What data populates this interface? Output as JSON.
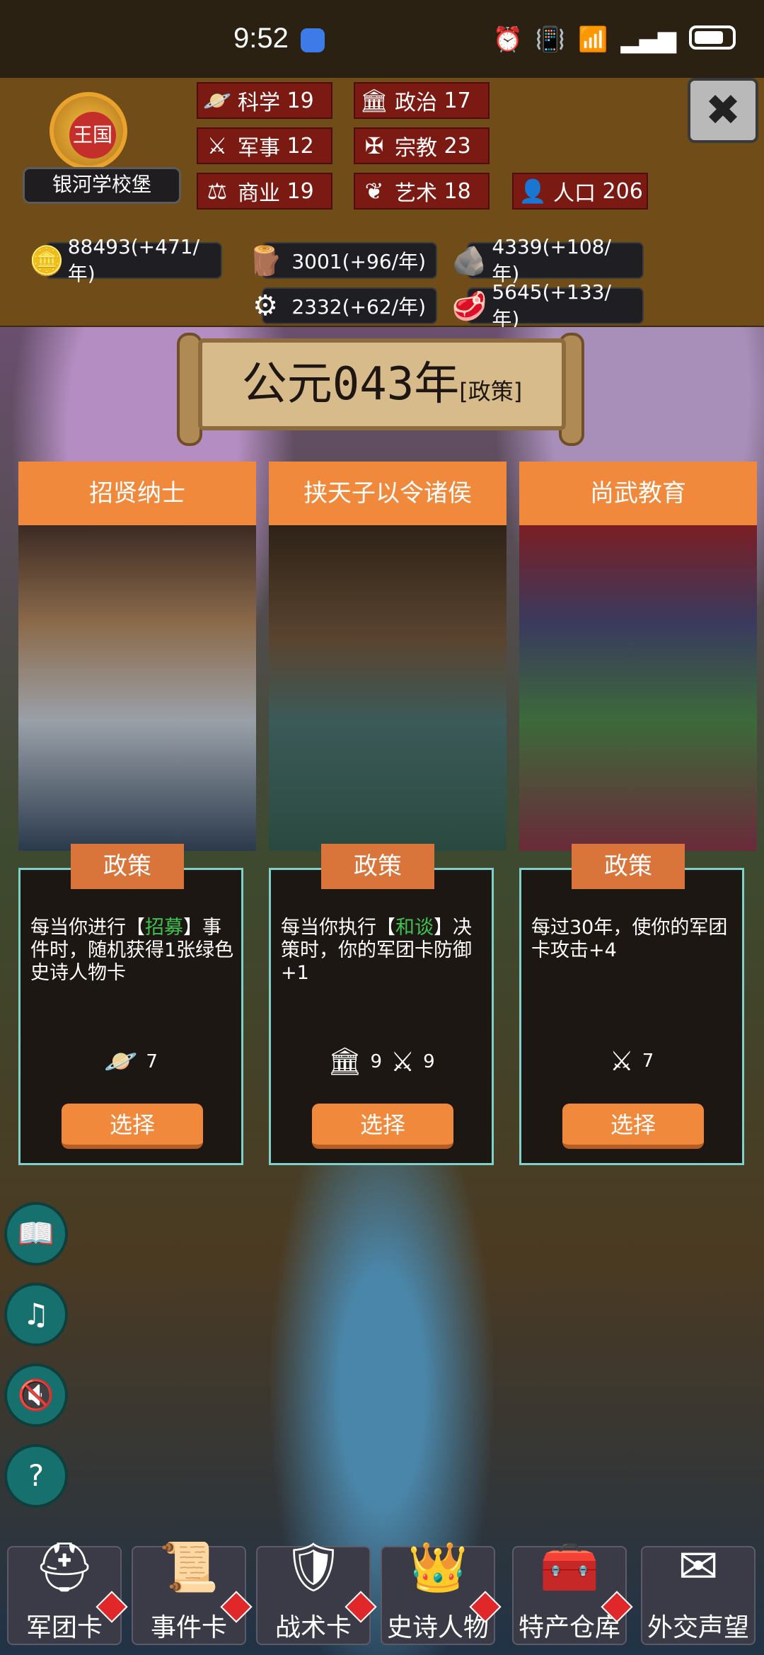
{
  "status_bar": {
    "time": "9:52"
  },
  "header": {
    "emblem_label": "王国",
    "kingdom_name": "银河学校堡",
    "close_symbol": "✖",
    "stats": [
      {
        "icon": "planet-icon",
        "glyph": "🪐",
        "label": "科学",
        "value": "19"
      },
      {
        "icon": "government-icon",
        "glyph": "🏛",
        "label": "政治",
        "value": "17"
      },
      {
        "icon": "crossed-swords-icon",
        "glyph": "⚔",
        "label": "军事",
        "value": "12"
      },
      {
        "icon": "religion-icon",
        "glyph": "✠",
        "label": "宗教",
        "value": "23"
      },
      {
        "icon": "scales-icon",
        "glyph": "⚖",
        "label": "商业",
        "value": "19"
      },
      {
        "icon": "art-icon",
        "glyph": "❦",
        "label": "艺术",
        "value": "18"
      },
      {
        "icon": "person-icon",
        "glyph": "👤",
        "label": "人口",
        "value": "206"
      }
    ],
    "resources": [
      {
        "icon": "coins-icon",
        "glyph": "🪙",
        "text": "88493(+471/年)"
      },
      {
        "icon": "wood-icon",
        "glyph": "🪵",
        "text": "3001(+96/年)"
      },
      {
        "icon": "stone-icon",
        "glyph": "🪨",
        "text": "4339(+108/年)"
      },
      {
        "icon": "tech-icon",
        "glyph": "⚙",
        "text": "2332(+62/年)"
      },
      {
        "icon": "meat-icon",
        "glyph": "🥩",
        "text": "5645(+133/年)"
      }
    ]
  },
  "banner": {
    "year": "公元043年",
    "phase": "[政策]"
  },
  "cards": [
    {
      "title": "招贤纳士",
      "tag": "政策",
      "desc_pre": "每当你进行【",
      "desc_green": "招募",
      "desc_post": "】事件时，随机获得1张绿色史诗人物卡",
      "costs": [
        {
          "icon": "planet-icon",
          "glyph": "🪐",
          "value": "7"
        }
      ],
      "button": "选择"
    },
    {
      "title": "挟天子以令诸侯",
      "tag": "政策",
      "desc_pre": "每当你执行【",
      "desc_green": "和谈",
      "desc_post": "】决策时，你的军团卡防御+1",
      "costs": [
        {
          "icon": "government-icon",
          "glyph": "🏛",
          "value": "9"
        },
        {
          "icon": "crossed-swords-icon",
          "glyph": "⚔",
          "value": "9"
        }
      ],
      "button": "选择"
    },
    {
      "title": "尚武教育",
      "tag": "政策",
      "desc_pre": "每过30年，使你的军团卡攻击+4",
      "desc_green": "",
      "desc_post": "",
      "costs": [
        {
          "icon": "crossed-swords-icon",
          "glyph": "⚔",
          "value": "7"
        }
      ],
      "button": "选择"
    }
  ],
  "side_buttons": [
    {
      "icon": "book-icon",
      "glyph": "📖"
    },
    {
      "icon": "music-off-icon",
      "glyph": "♫"
    },
    {
      "icon": "sound-off-icon",
      "glyph": "🔇"
    },
    {
      "icon": "help-icon",
      "glyph": "?"
    }
  ],
  "nav": [
    {
      "icon": "helmet-icon",
      "glyph": "⛑",
      "label": "军团卡"
    },
    {
      "icon": "scroll-icon",
      "glyph": "📜",
      "label": "事件卡"
    },
    {
      "icon": "shield-icon",
      "glyph": "🛡",
      "label": "战术卡"
    },
    {
      "icon": "crown-icon",
      "glyph": "👑",
      "label": "史诗人物"
    },
    {
      "icon": "chest-icon",
      "glyph": "🧰",
      "label": "特产仓库"
    },
    {
      "icon": "letter-icon",
      "glyph": "✉",
      "label": "外交声望"
    }
  ],
  "colors": {
    "accent_orange": "#f0893b",
    "stat_red": "#7b1a12",
    "card_border": "#7fd0c9",
    "green_text": "#3fc34f"
  }
}
